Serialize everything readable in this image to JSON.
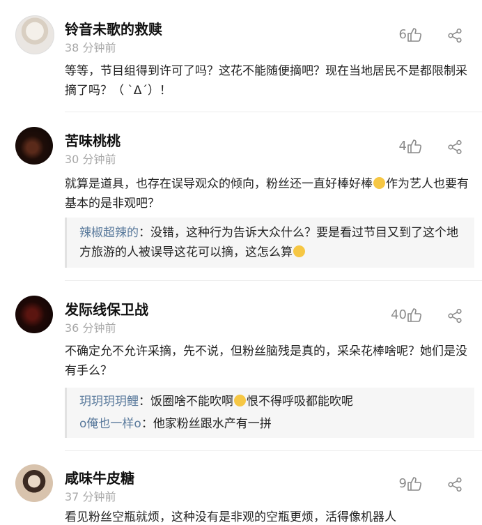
{
  "comments": [
    {
      "username": "铃音未歌的救赎",
      "time": "38 分钟前",
      "likes": "6",
      "text": "等等，节目组得到许可了吗？这花不能随便摘吧？现在当地居民不是都限制采摘了吗？（ `Δ´）！"
    },
    {
      "username": "苦味桃桃",
      "time": "30 分钟前",
      "likes": "4",
      "text_before_emoji": "就算是道具，也存在误导观众的倾向，粉丝还一直好棒好棒",
      "text_after_emoji": "作为艺人也要有基本的是非观吧？",
      "replies": [
        {
          "name": "辣椒超辣的",
          "sep": "：",
          "text_before_emoji": "没错，这种行为告诉大众什么？要是看过节目又到了这个地方旅游的人被误导这花可以摘，这怎么算",
          "text_after_emoji": ""
        }
      ]
    },
    {
      "username": "发际线保卫战",
      "time": "36 分钟前",
      "likes": "40",
      "text": "不确定允不允许采摘，先不说，但粉丝脑残是真的，采朵花棒啥呢？她们是没有手么？",
      "replies": [
        {
          "name": "玥玥玥玥鲤",
          "sep": "：",
          "text_before_emoji": "饭圈啥不能吹啊",
          "text_after_emoji": "恨不得呼吸都能吹呢"
        },
        {
          "name": "o俺也一样o",
          "sep": "：",
          "text_before_emoji": "他家粉丝跟水产有一拼",
          "text_after_emoji": ""
        }
      ]
    },
    {
      "username": "咸味牛皮糖",
      "time": "37 分钟前",
      "likes": "9",
      "text": "看见粉丝空瓶就烦，这种没有是非观的空瓶更烦，活得像机器人"
    }
  ]
}
